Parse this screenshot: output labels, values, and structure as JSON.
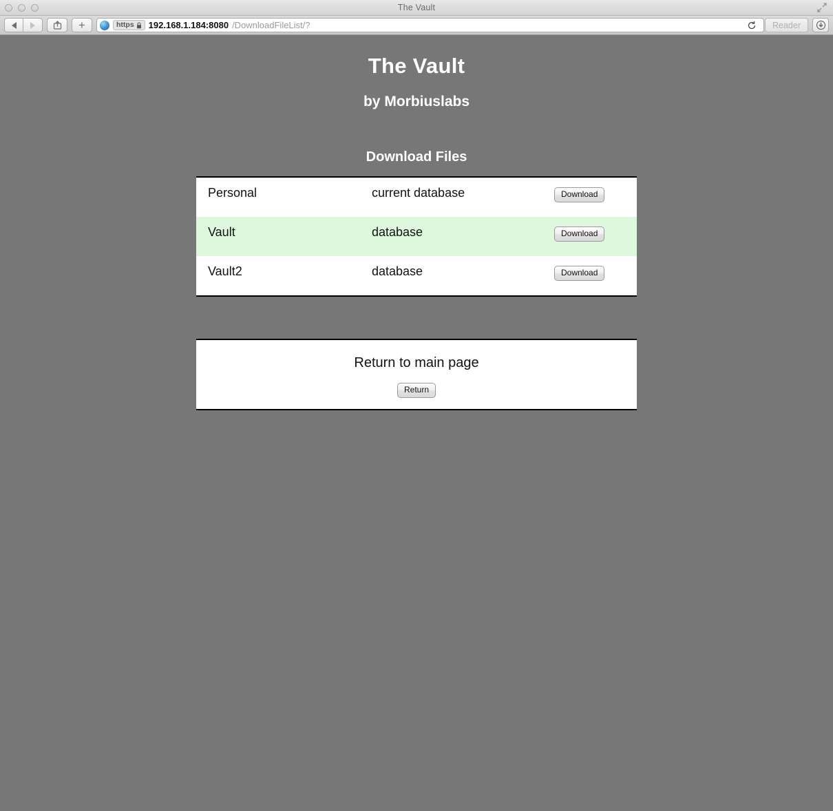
{
  "window": {
    "title": "The Vault",
    "traffic_lights": [
      "close",
      "minimize",
      "zoom"
    ],
    "fullscreen_icon": "expand-icon"
  },
  "toolbar": {
    "back_icon": "back-arrow-icon",
    "forward_icon": "forward-arrow-icon",
    "share_icon": "share-icon",
    "add_tab_label": "+",
    "reload_icon": "reload-icon",
    "reader_label": "Reader",
    "downloads_icon": "downloads-icon",
    "url": {
      "site_icon": "globe-icon",
      "scheme_badge": "https",
      "lock_icon": "lock-icon",
      "host": "192.168.1.184:8080",
      "path": "/DownloadFileList/?"
    }
  },
  "page": {
    "title": "The Vault",
    "subtitle": "by Morbiuslabs",
    "section_title": "Download Files",
    "highlight_color": "#ddf8dc",
    "background_color": "#777777",
    "files": [
      {
        "name": "Personal",
        "description": "current database",
        "action_label": "Download",
        "highlighted": false
      },
      {
        "name": "Vault",
        "description": "database",
        "action_label": "Download",
        "highlighted": true
      },
      {
        "name": "Vault2",
        "description": "database",
        "action_label": "Download",
        "highlighted": false
      }
    ],
    "return_panel": {
      "text": "Return to main page",
      "button_label": "Return"
    }
  }
}
